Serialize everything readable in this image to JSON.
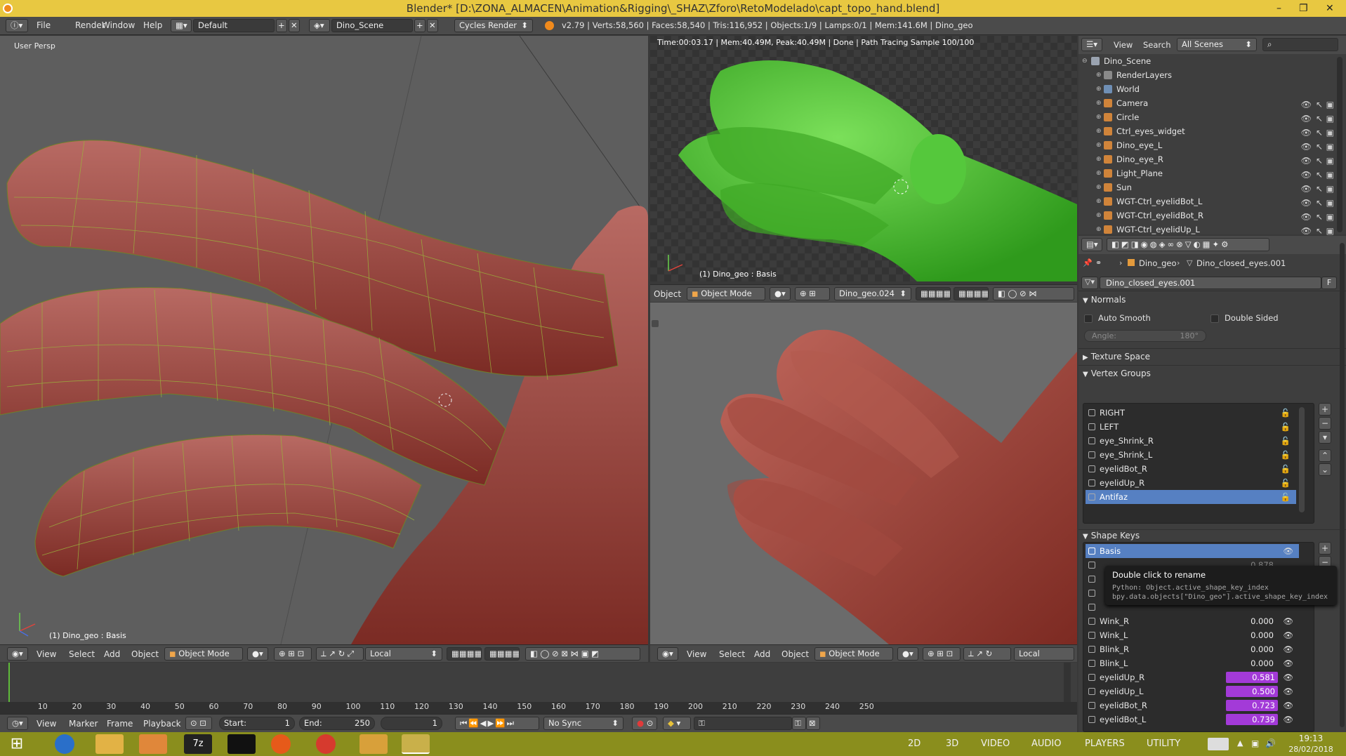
{
  "window": {
    "title": "Blender* [D:\\ZONA_ALMACEN\\Animation&Rigging\\_SHAZ\\Zforo\\RetoModelado\\capt_topo_hand.blend]",
    "minimize": "–",
    "maximize": "❐",
    "close": "✕"
  },
  "infobar": {
    "menus": [
      "File",
      "Render",
      "Window",
      "Help"
    ],
    "layout": "Default",
    "scene": "Dino_Scene",
    "engine": "Cycles Render",
    "stats": "v2.79 | Verts:58,560 | Faces:58,540 | Tris:116,952 | Objects:1/9 | Lamps:0/1 | Mem:141.6M | Dino_geo"
  },
  "viewport_left": {
    "label": "User Persp",
    "object_info": "(1) Dino_geo : Basis",
    "header": {
      "menus": [
        "View",
        "Select",
        "Add",
        "Object"
      ],
      "mode": "Object Mode",
      "orientation": "Local"
    }
  },
  "viewport_render": {
    "status": "Time:00:03.17 | Mem:40.49M, Peak:40.49M | Done | Path Tracing Sample 100/100",
    "object_info": "(1) Dino_geo : Basis",
    "header": {
      "menu": "Object",
      "mode": "Object Mode",
      "datablock": "Dino_geo.024"
    }
  },
  "viewport_bottom": {
    "header": {
      "menus": [
        "View",
        "Select",
        "Add",
        "Object"
      ],
      "mode": "Object Mode",
      "orientation": "Local"
    }
  },
  "outliner": {
    "menus": [
      "View",
      "Search"
    ],
    "filter": "All Scenes",
    "root": "Dino_Scene",
    "items": [
      {
        "label": "RenderLayers",
        "color": "#8a8a8a"
      },
      {
        "label": "World",
        "color": "#6f8fb5"
      },
      {
        "label": "Camera",
        "color": "#d0843a"
      },
      {
        "label": "Circle",
        "color": "#d0843a"
      },
      {
        "label": "Ctrl_eyes_widget",
        "color": "#d0843a"
      },
      {
        "label": "Dino_eye_L",
        "color": "#d0843a"
      },
      {
        "label": "Dino_eye_R",
        "color": "#d0843a"
      },
      {
        "label": "Light_Plane",
        "color": "#d0843a"
      },
      {
        "label": "Sun",
        "color": "#d0843a"
      },
      {
        "label": "WGT-Ctrl_eyelidBot_L",
        "color": "#d0843a"
      },
      {
        "label": "WGT-Ctrl_eyelidBot_R",
        "color": "#d0843a"
      },
      {
        "label": "WGT-Ctrl_eyelidUp_L",
        "color": "#d0843a"
      }
    ]
  },
  "properties": {
    "breadcrumb_object": "Dino_geo",
    "breadcrumb_mesh": "Dino_closed_eyes.001",
    "mesh_name": "Dino_closed_eyes.001",
    "fake_user": "F",
    "normals": {
      "title": "Normals",
      "auto_smooth": "Auto Smooth",
      "double_sided": "Double Sided",
      "angle": "Angle:",
      "angle_value": "180°"
    },
    "texture_space": "Texture Space",
    "vertex_groups": {
      "title": "Vertex Groups",
      "items": [
        "RIGHT",
        "LEFT",
        "eye_Shrink_R",
        "eye_Shrink_L",
        "eyelidBot_R",
        "eyelidUp_R",
        "Antifaz"
      ],
      "active_index": 6
    },
    "shape_keys": {
      "title": "Shape Keys",
      "basis": "Basis",
      "items": [
        {
          "name": "Wink_R",
          "value": "0.000",
          "bar": false
        },
        {
          "name": "Wink_L",
          "value": "0.000",
          "bar": false
        },
        {
          "name": "Blink_R",
          "value": "0.000",
          "bar": false
        },
        {
          "name": "Blink_L",
          "value": "0.000",
          "bar": false
        },
        {
          "name": "eyelidUp_R",
          "value": "0.581",
          "bar": true
        },
        {
          "name": "eyelidUp_L",
          "value": "0.500",
          "bar": true
        },
        {
          "name": "eyelidBot_R",
          "value": "0.723",
          "bar": true
        },
        {
          "name": "eyelidBot_L",
          "value": "0.739",
          "bar": true
        }
      ],
      "hidden_value_1": "0.878"
    },
    "tooltip": {
      "title": "Double click to rename",
      "line1": "Python: Object.active_shape_key_index",
      "line2": "bpy.data.objects[\"Dino_geo\"].active_shape_key_index"
    }
  },
  "timeline": {
    "ticks": [
      "10",
      "20",
      "30",
      "40",
      "50",
      "60",
      "70",
      "80",
      "90",
      "100",
      "110",
      "120",
      "130",
      "140",
      "150",
      "160",
      "170",
      "180",
      "190",
      "200",
      "210",
      "220",
      "230",
      "240",
      "250"
    ],
    "menus": [
      "View",
      "Marker",
      "Frame",
      "Playback"
    ],
    "start_label": "Start:",
    "start_value": "1",
    "end_label": "End:",
    "end_value": "250",
    "current_frame": "1",
    "sync": "No Sync"
  },
  "taskbar": {
    "tray_items": [
      "2D",
      "3D",
      "VIDEO",
      "AUDIO",
      "PLAYERS",
      "UTILITY"
    ],
    "time": "19:13",
    "date": "28/02/2018"
  }
}
